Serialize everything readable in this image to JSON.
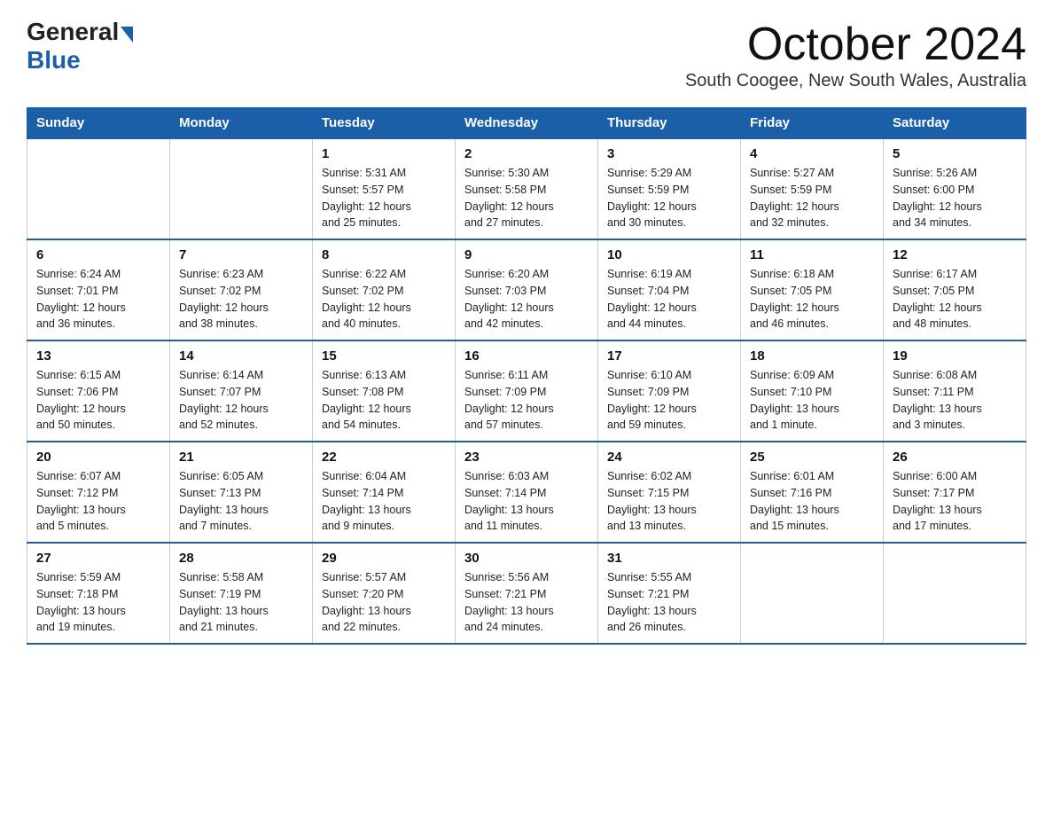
{
  "header": {
    "logo_general": "General",
    "logo_blue": "Blue",
    "month_title": "October 2024",
    "location": "South Coogee, New South Wales, Australia"
  },
  "days_of_week": [
    "Sunday",
    "Monday",
    "Tuesday",
    "Wednesday",
    "Thursday",
    "Friday",
    "Saturday"
  ],
  "weeks": [
    [
      {
        "day": "",
        "info": ""
      },
      {
        "day": "",
        "info": ""
      },
      {
        "day": "1",
        "info": "Sunrise: 5:31 AM\nSunset: 5:57 PM\nDaylight: 12 hours\nand 25 minutes."
      },
      {
        "day": "2",
        "info": "Sunrise: 5:30 AM\nSunset: 5:58 PM\nDaylight: 12 hours\nand 27 minutes."
      },
      {
        "day": "3",
        "info": "Sunrise: 5:29 AM\nSunset: 5:59 PM\nDaylight: 12 hours\nand 30 minutes."
      },
      {
        "day": "4",
        "info": "Sunrise: 5:27 AM\nSunset: 5:59 PM\nDaylight: 12 hours\nand 32 minutes."
      },
      {
        "day": "5",
        "info": "Sunrise: 5:26 AM\nSunset: 6:00 PM\nDaylight: 12 hours\nand 34 minutes."
      }
    ],
    [
      {
        "day": "6",
        "info": "Sunrise: 6:24 AM\nSunset: 7:01 PM\nDaylight: 12 hours\nand 36 minutes."
      },
      {
        "day": "7",
        "info": "Sunrise: 6:23 AM\nSunset: 7:02 PM\nDaylight: 12 hours\nand 38 minutes."
      },
      {
        "day": "8",
        "info": "Sunrise: 6:22 AM\nSunset: 7:02 PM\nDaylight: 12 hours\nand 40 minutes."
      },
      {
        "day": "9",
        "info": "Sunrise: 6:20 AM\nSunset: 7:03 PM\nDaylight: 12 hours\nand 42 minutes."
      },
      {
        "day": "10",
        "info": "Sunrise: 6:19 AM\nSunset: 7:04 PM\nDaylight: 12 hours\nand 44 minutes."
      },
      {
        "day": "11",
        "info": "Sunrise: 6:18 AM\nSunset: 7:05 PM\nDaylight: 12 hours\nand 46 minutes."
      },
      {
        "day": "12",
        "info": "Sunrise: 6:17 AM\nSunset: 7:05 PM\nDaylight: 12 hours\nand 48 minutes."
      }
    ],
    [
      {
        "day": "13",
        "info": "Sunrise: 6:15 AM\nSunset: 7:06 PM\nDaylight: 12 hours\nand 50 minutes."
      },
      {
        "day": "14",
        "info": "Sunrise: 6:14 AM\nSunset: 7:07 PM\nDaylight: 12 hours\nand 52 minutes."
      },
      {
        "day": "15",
        "info": "Sunrise: 6:13 AM\nSunset: 7:08 PM\nDaylight: 12 hours\nand 54 minutes."
      },
      {
        "day": "16",
        "info": "Sunrise: 6:11 AM\nSunset: 7:09 PM\nDaylight: 12 hours\nand 57 minutes."
      },
      {
        "day": "17",
        "info": "Sunrise: 6:10 AM\nSunset: 7:09 PM\nDaylight: 12 hours\nand 59 minutes."
      },
      {
        "day": "18",
        "info": "Sunrise: 6:09 AM\nSunset: 7:10 PM\nDaylight: 13 hours\nand 1 minute."
      },
      {
        "day": "19",
        "info": "Sunrise: 6:08 AM\nSunset: 7:11 PM\nDaylight: 13 hours\nand 3 minutes."
      }
    ],
    [
      {
        "day": "20",
        "info": "Sunrise: 6:07 AM\nSunset: 7:12 PM\nDaylight: 13 hours\nand 5 minutes."
      },
      {
        "day": "21",
        "info": "Sunrise: 6:05 AM\nSunset: 7:13 PM\nDaylight: 13 hours\nand 7 minutes."
      },
      {
        "day": "22",
        "info": "Sunrise: 6:04 AM\nSunset: 7:14 PM\nDaylight: 13 hours\nand 9 minutes."
      },
      {
        "day": "23",
        "info": "Sunrise: 6:03 AM\nSunset: 7:14 PM\nDaylight: 13 hours\nand 11 minutes."
      },
      {
        "day": "24",
        "info": "Sunrise: 6:02 AM\nSunset: 7:15 PM\nDaylight: 13 hours\nand 13 minutes."
      },
      {
        "day": "25",
        "info": "Sunrise: 6:01 AM\nSunset: 7:16 PM\nDaylight: 13 hours\nand 15 minutes."
      },
      {
        "day": "26",
        "info": "Sunrise: 6:00 AM\nSunset: 7:17 PM\nDaylight: 13 hours\nand 17 minutes."
      }
    ],
    [
      {
        "day": "27",
        "info": "Sunrise: 5:59 AM\nSunset: 7:18 PM\nDaylight: 13 hours\nand 19 minutes."
      },
      {
        "day": "28",
        "info": "Sunrise: 5:58 AM\nSunset: 7:19 PM\nDaylight: 13 hours\nand 21 minutes."
      },
      {
        "day": "29",
        "info": "Sunrise: 5:57 AM\nSunset: 7:20 PM\nDaylight: 13 hours\nand 22 minutes."
      },
      {
        "day": "30",
        "info": "Sunrise: 5:56 AM\nSunset: 7:21 PM\nDaylight: 13 hours\nand 24 minutes."
      },
      {
        "day": "31",
        "info": "Sunrise: 5:55 AM\nSunset: 7:21 PM\nDaylight: 13 hours\nand 26 minutes."
      },
      {
        "day": "",
        "info": ""
      },
      {
        "day": "",
        "info": ""
      }
    ]
  ]
}
